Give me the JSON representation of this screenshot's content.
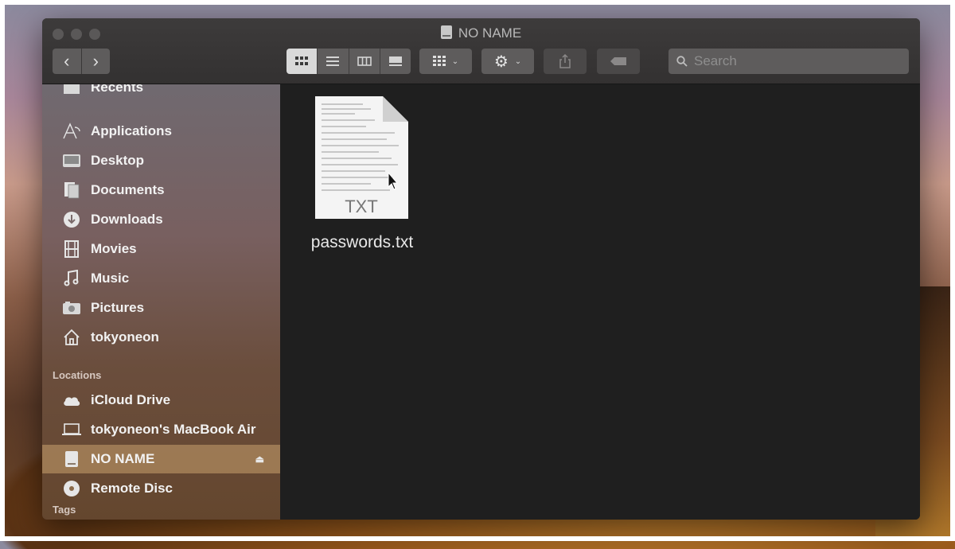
{
  "window": {
    "title": "NO NAME"
  },
  "toolbar": {
    "back_label": "‹",
    "forward_label": "›",
    "search_placeholder": "Search",
    "view_modes": [
      "icon-view-icon",
      "list-view-icon",
      "column-view-icon",
      "gallery-view-icon"
    ],
    "active_view": "icon-view-icon"
  },
  "sidebar": {
    "partial_top_label": "Recents",
    "favorites": [
      {
        "label": "Applications",
        "icon": "applications-icon"
      },
      {
        "label": "Desktop",
        "icon": "desktop-icon"
      },
      {
        "label": "Documents",
        "icon": "documents-icon"
      },
      {
        "label": "Downloads",
        "icon": "downloads-icon"
      },
      {
        "label": "Movies",
        "icon": "movies-icon"
      },
      {
        "label": "Music",
        "icon": "music-icon"
      },
      {
        "label": "Pictures",
        "icon": "pictures-icon"
      },
      {
        "label": "tokyoneon",
        "icon": "home-icon"
      }
    ],
    "locations_header": "Locations",
    "locations": [
      {
        "label": "iCloud Drive",
        "icon": "icloud-icon"
      },
      {
        "label": "tokyoneon's MacBook Air",
        "icon": "laptop-icon"
      },
      {
        "label": "NO NAME",
        "icon": "drive-icon",
        "selected": true,
        "eject": "⏏"
      },
      {
        "label": "Remote Disc",
        "icon": "disc-icon"
      }
    ],
    "tags_header": "Tags"
  },
  "content": {
    "files": [
      {
        "name": "passwords.txt",
        "badge": "TXT",
        "icon": "text-file-icon"
      }
    ]
  },
  "colors": {
    "window_bg": "#1e1e1e",
    "titlebar": "#383636",
    "selected_row": "#b08a5e"
  }
}
